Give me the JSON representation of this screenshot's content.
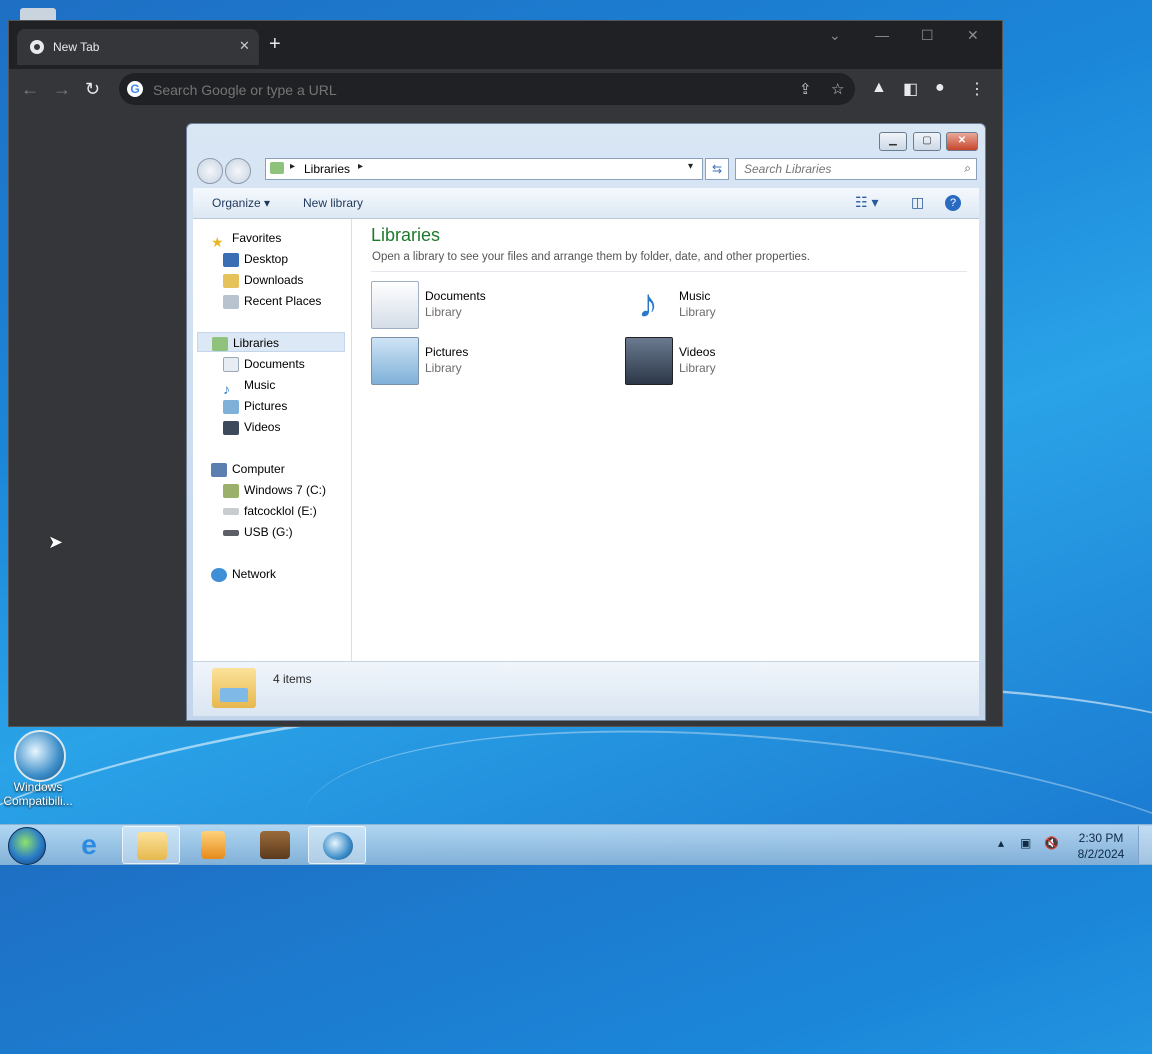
{
  "desktop": {
    "icons": [
      {
        "label": "Windows Compatibili...",
        "icon": "windows-compatibility-icon"
      }
    ]
  },
  "chrome": {
    "tab": {
      "title": "New Tab",
      "icon": "chrome-icon"
    },
    "omnibox": {
      "placeholder": "Search Google or type a URL"
    },
    "window_controls": [
      "minimize",
      "maximize",
      "close"
    ]
  },
  "explorer": {
    "address": {
      "breadcrumb": "Libraries"
    },
    "search": {
      "placeholder": "Search Libraries"
    },
    "commands": {
      "organize": "Organize",
      "new_library": "New library"
    },
    "nav": {
      "favorites": {
        "label": "Favorites",
        "items": [
          "Desktop",
          "Downloads",
          "Recent Places"
        ]
      },
      "libraries": {
        "label": "Libraries",
        "items": [
          "Documents",
          "Music",
          "Pictures",
          "Videos"
        ]
      },
      "computer": {
        "label": "Computer",
        "items": [
          "Windows 7 (C:)",
          "fatcocklol (E:)",
          "USB (G:)"
        ]
      },
      "network": {
        "label": "Network"
      }
    },
    "content": {
      "title": "Libraries",
      "subtitle": "Open a library to see your files and arrange them by folder, date, and other properties.",
      "libraries": [
        {
          "name": "Documents",
          "kind": "Library"
        },
        {
          "name": "Music",
          "kind": "Library"
        },
        {
          "name": "Pictures",
          "kind": "Library"
        },
        {
          "name": "Videos",
          "kind": "Library"
        }
      ]
    },
    "status": {
      "count": "4 items"
    }
  },
  "taskbar": {
    "clock": {
      "time": "2:30 PM",
      "date": "8/2/2024"
    },
    "apps": [
      "internet-explorer",
      "windows-explorer",
      "media-player",
      "archive-manager",
      "windows-compatibility"
    ]
  },
  "colors": {
    "library_title": "#1e7a2c",
    "chrome_bg": "#202124"
  }
}
